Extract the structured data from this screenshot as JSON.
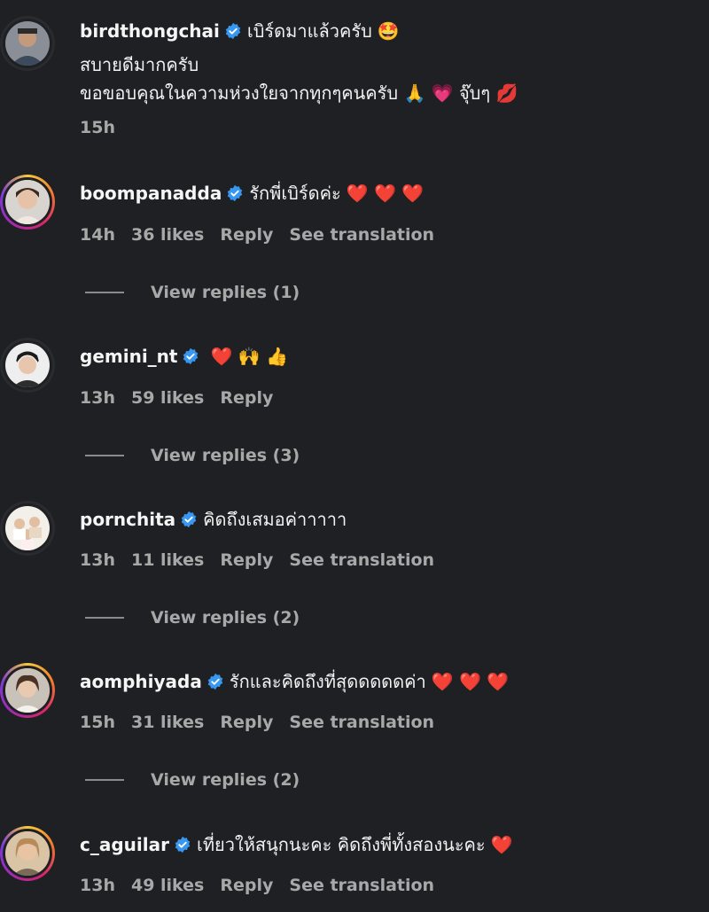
{
  "comments": [
    {
      "username": "birdthongchai",
      "text": "เบิร์ดมาแล้วครับ",
      "emoji": "🤩",
      "extra_lines": [
        "สบายดีมากครับ",
        "ขอขอบคุณในความห่วงใยจากทุกๆคนครับ 🙏 💗 จุ๊บๆ 💋"
      ],
      "time": "15h",
      "likes": "",
      "reply": "",
      "translation": "",
      "view_replies": ""
    },
    {
      "username": "boompanadda",
      "text": "รักพี่เบิร์ดค่ะ",
      "emoji": "❤️ ❤️ ❤️",
      "time": "14h",
      "likes": "36 likes",
      "reply": "Reply",
      "translation": "See translation",
      "view_replies": "View replies (1)"
    },
    {
      "username": "gemini_nt",
      "text": "",
      "emoji": "❤️ 🙌 👍",
      "time": "13h",
      "likes": "59 likes",
      "reply": "Reply",
      "translation": "",
      "view_replies": "View replies (3)"
    },
    {
      "username": "pornchita",
      "text": "คิดถึงเสมอค่าาาาา",
      "emoji": "",
      "time": "13h",
      "likes": "11 likes",
      "reply": "Reply",
      "translation": "See translation",
      "view_replies": "View replies (2)"
    },
    {
      "username": "aomphiyada",
      "text": "รักและคิดถึงที่สุดดดดดค่า",
      "emoji": "❤️ ❤️ ❤️",
      "time": "15h",
      "likes": "31 likes",
      "reply": "Reply",
      "translation": "See translation",
      "view_replies": "View replies (2)"
    },
    {
      "username": "c_aguilar",
      "text": "เที่ยวให้สนุกนะคะ คิดถึงพี่ทั้งสองนะคะ",
      "emoji": "❤️",
      "time": "13h",
      "likes": "49 likes",
      "reply": "Reply",
      "translation": "See translation",
      "view_replies": ""
    }
  ],
  "colors": {
    "background": "#1f2023",
    "meta_text": "#a8a8a8",
    "verified": "#3897f0"
  }
}
